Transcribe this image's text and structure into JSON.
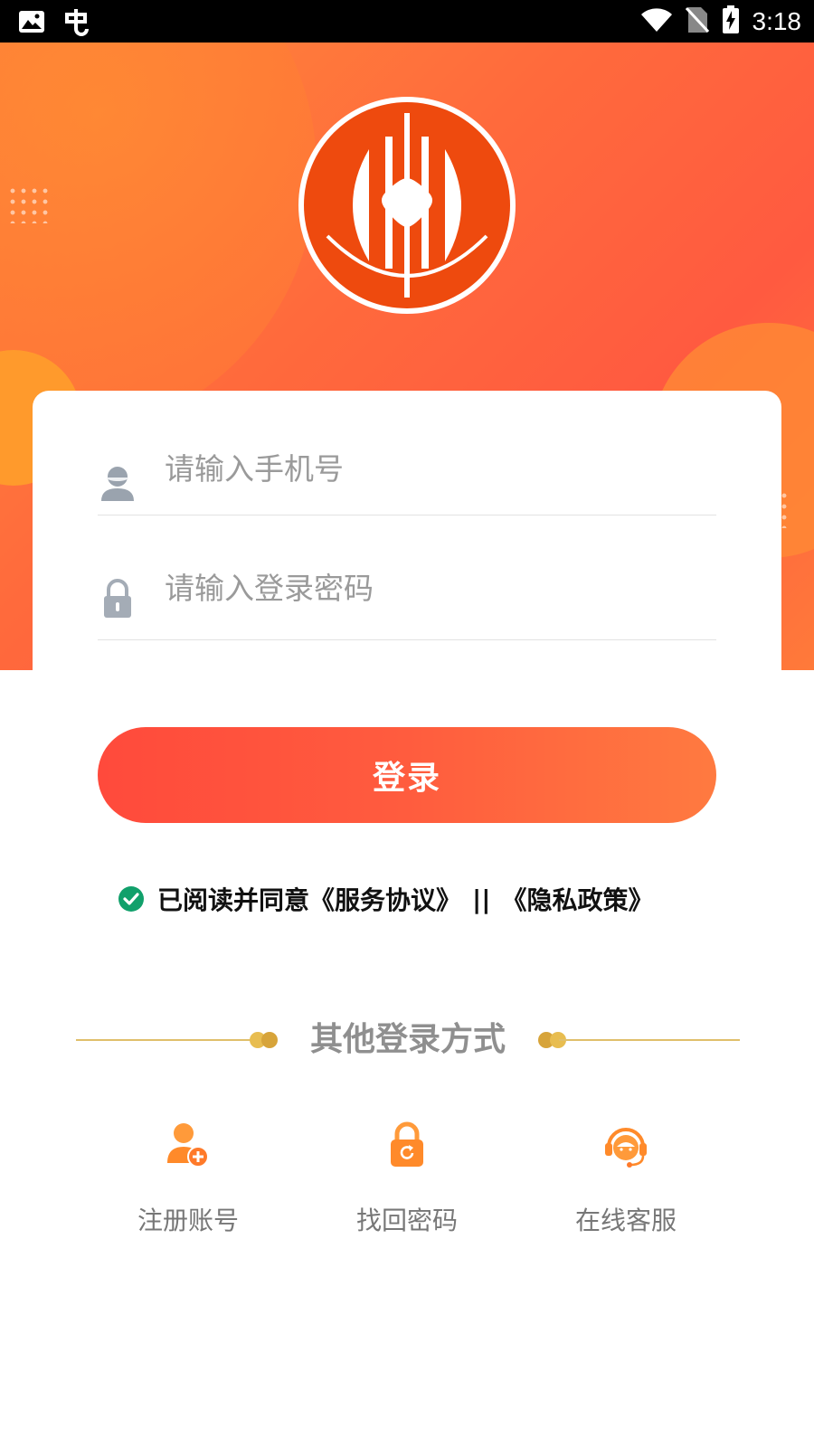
{
  "status_bar": {
    "time": "3:18",
    "icons": [
      "gallery-icon",
      "bug-icon",
      "wifi-icon",
      "no-sim-icon",
      "battery-charging-icon"
    ]
  },
  "logo": {
    "icon": "bank-coin-logo-icon",
    "color": "#ee4a0e"
  },
  "form": {
    "phone_placeholder": "请输入手机号",
    "password_placeholder": "请输入登录密码",
    "phone_icon": "user-icon",
    "password_icon": "lock-icon"
  },
  "login_button": {
    "label": "登录",
    "gradient": [
      "#ff4a3c",
      "#ff7a40"
    ]
  },
  "agreement": {
    "prefix": "已阅读并同意",
    "service_link": "《服务协议》",
    "separator": "||",
    "privacy_link": "《隐私政策》",
    "checked": true,
    "check_color": "#11a06b"
  },
  "other_login": {
    "title": "其他登录方式",
    "options": [
      {
        "label": "注册账号",
        "icon": "add-user-icon"
      },
      {
        "label": "找回密码",
        "icon": "reset-lock-icon"
      },
      {
        "label": "在线客服",
        "icon": "customer-service-icon"
      }
    ],
    "accent": "#ff8a2a"
  }
}
